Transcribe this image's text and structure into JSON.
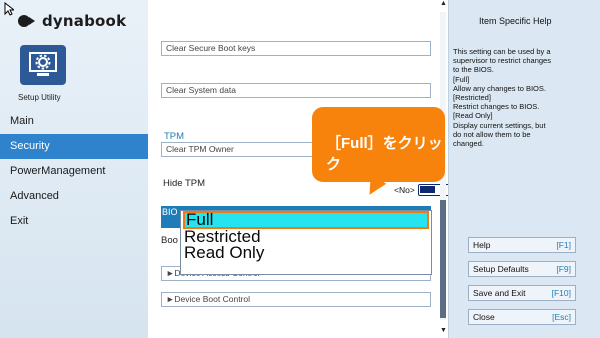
{
  "brand": {
    "logo_text": "dynabook"
  },
  "sidebar": {
    "setup_label": "Setup Utility",
    "items": [
      {
        "label": "Main",
        "active": false
      },
      {
        "label": "Security",
        "active": true
      },
      {
        "label": "PowerManagement",
        "active": false
      },
      {
        "label": "Advanced",
        "active": false
      },
      {
        "label": "Exit",
        "active": false
      }
    ]
  },
  "main": {
    "clear_secure_boot_keys": "Clear Secure Boot keys",
    "clear_system_data": "Clear System data",
    "tpm_heading": "TPM",
    "clear_tpm_owner": "Clear TPM Owner",
    "hide_tpm_label": "Hide TPM",
    "hide_tpm_state": "<No>",
    "bios_row_prefix": "BIO",
    "boot_row_prefix": "Boo",
    "device_access_control": "►Device Access Control",
    "device_boot_control": "►Device Boot Control"
  },
  "dropdown": {
    "options": [
      "Full",
      "Restricted",
      "Read Only"
    ],
    "selected": "Full"
  },
  "help": {
    "title": "Item Specific Help",
    "lines": [
      "This setting can be used by a",
      "supervisor to restrict changes",
      "to the BIOS.",
      "[Full]",
      "Allow any changes to BIOS.",
      "[Restricted]",
      "Restrict changes to BIOS.",
      "[Read Only]",
      "Display current settings, but",
      "do not allow them to be",
      "changed."
    ],
    "buttons": [
      {
        "label": "Help",
        "key": "[F1]"
      },
      {
        "label": "Setup Defaults",
        "key": "[F9]"
      },
      {
        "label": "Save and Exit",
        "key": "[F10]"
      },
      {
        "label": "Close",
        "key": "[Esc]"
      }
    ]
  },
  "callout": {
    "text": "［Full］をクリック"
  },
  "colors": {
    "accent": "#2f83cc",
    "callout": "#f7830c",
    "highlight": "#25e3ef",
    "selection_border": "#ee7a12"
  }
}
